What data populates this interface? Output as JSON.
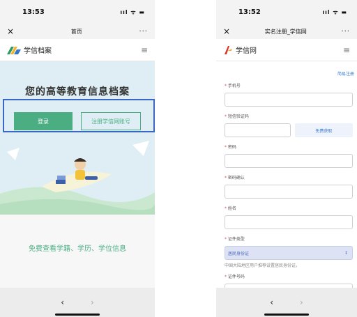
{
  "left": {
    "status": {
      "time": "13:53",
      "icons": "ııl ᯤ ▬"
    },
    "nav": {
      "close": "×",
      "title": "首页",
      "more": "···"
    },
    "header": {
      "brand": "学信档案",
      "menu": "≡"
    },
    "hero": {
      "title": "您的高等教育信息档案",
      "login_label": "登录",
      "register_label": "注册学信网账号"
    },
    "tagline": "免费查看学籍、学历、学位信息",
    "bottom": {
      "back": "‹",
      "forward": "›"
    }
  },
  "right": {
    "status": {
      "time": "13:52",
      "icons": "ııl ᯤ ▬"
    },
    "nav": {
      "close": "×",
      "title": "实名注册_学信网",
      "more": "···"
    },
    "header": {
      "brand": "学信网",
      "menu": "≡"
    },
    "form": {
      "register_link": "简易注册",
      "required_mark": "*",
      "phone_label": "手机号",
      "code_label": "短信验证码",
      "code_button": "免费获取",
      "password_label": "密码",
      "confirm_label": "密码确认",
      "name_label": "姓名",
      "id_type_label": "证件类型",
      "id_type_value": "居民身份证",
      "id_type_hint": "中国大陆地区用户推荐设置居民身份证。",
      "id_number_label": "证件号码"
    },
    "bottom": {
      "back": "‹",
      "forward": "›"
    }
  },
  "colors": {
    "accent_green": "#4bae83",
    "highlight_blue": "#3a66c4",
    "link_blue": "#3a7fd0",
    "required_red": "#e05050"
  }
}
